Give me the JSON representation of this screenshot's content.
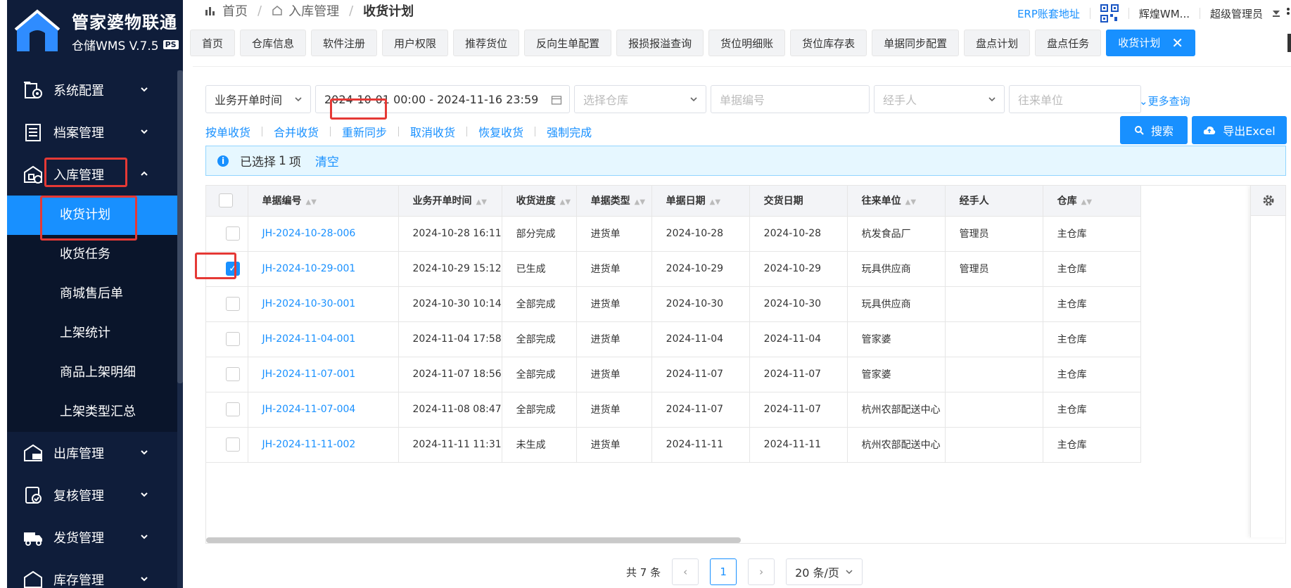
{
  "app": {
    "logo_title": "管家婆物联通",
    "logo_subtitle": "仓储WMS V.7.5",
    "logo_badge": "PS"
  },
  "sidebar": {
    "groups": [
      {
        "label": "系统配置",
        "icon": "gear-doc-icon"
      },
      {
        "label": "档案管理",
        "icon": "archive-icon"
      },
      {
        "label": "入库管理",
        "icon": "inbound-icon",
        "expanded": true
      },
      {
        "label": "出库管理",
        "icon": "outbound-icon"
      },
      {
        "label": "复核管理",
        "icon": "review-icon"
      },
      {
        "label": "发货管理",
        "icon": "truck-icon"
      },
      {
        "label": "库存管理",
        "icon": "stock-icon"
      }
    ],
    "inbound_items": [
      {
        "label": "收货计划",
        "active": true
      },
      {
        "label": "收货任务"
      },
      {
        "label": "商城售后单"
      },
      {
        "label": "上架统计"
      },
      {
        "label": "商品上架明细"
      },
      {
        "label": "上架类型汇总"
      }
    ]
  },
  "breadcrumb": {
    "home": "首页",
    "level1": "入库管理",
    "current": "收货计划"
  },
  "top_right": {
    "erp_link": "ERP账套地址",
    "user_short": "辉煌WM...",
    "role": "超级管理员"
  },
  "tabs": [
    "首页",
    "仓库信息",
    "软件注册",
    "用户权限",
    "推荐货位",
    "反向生单配置",
    "报损报溢查询",
    "货位明细账",
    "货位库存表",
    "单据同步配置",
    "盘点计划",
    "盘点任务"
  ],
  "active_tab": "收货计划",
  "filters": {
    "time_type": "业务开单时间",
    "date_range": "2024-10-01 00:00 - 2024-11-16 23:59",
    "warehouse_placeholder": "选择仓库",
    "bill_no_placeholder": "单据编号",
    "handler_placeholder": "经手人",
    "partner_placeholder": "往来单位",
    "more": "更多查询"
  },
  "actions": [
    "按单收货",
    "合并收货",
    "重新同步",
    "取消收货",
    "恢复收货",
    "强制完成"
  ],
  "buttons": {
    "search": "搜索",
    "export": "导出Excel"
  },
  "selection": {
    "prefix": "已选择",
    "count": "1",
    "suffix": "项",
    "clear": "清空"
  },
  "table": {
    "columns": [
      "单据编号",
      "业务开单时间",
      "收货进度",
      "单据类型",
      "单据日期",
      "交货日期",
      "往来单位",
      "经手人",
      "仓库"
    ],
    "rows": [
      {
        "no": "JH-2024-10-28-006",
        "time": "2024-10-28 16:11",
        "progress": "部分完成",
        "type": "进货单",
        "date": "2024-10-28",
        "delivery": "2024-10-28",
        "partner": "杭发食品厂",
        "handler": "管理员",
        "warehouse": "主仓库",
        "checked": false
      },
      {
        "no": "JH-2024-10-29-001",
        "time": "2024-10-29 15:12",
        "progress": "已生成",
        "type": "进货单",
        "date": "2024-10-29",
        "delivery": "2024-10-29",
        "partner": "玩具供应商",
        "handler": "管理员",
        "warehouse": "主仓库",
        "checked": true
      },
      {
        "no": "JH-2024-10-30-001",
        "time": "2024-10-30 10:14",
        "progress": "全部完成",
        "type": "进货单",
        "date": "2024-10-30",
        "delivery": "2024-10-30",
        "partner": "玩具供应商",
        "handler": "",
        "warehouse": "主仓库",
        "checked": false
      },
      {
        "no": "JH-2024-11-04-001",
        "time": "2024-11-04 17:58",
        "progress": "全部完成",
        "type": "进货单",
        "date": "2024-11-04",
        "delivery": "2024-11-04",
        "partner": "管家婆",
        "handler": "",
        "warehouse": "主仓库",
        "checked": false
      },
      {
        "no": "JH-2024-11-07-001",
        "time": "2024-11-07 18:56",
        "progress": "全部完成",
        "type": "进货单",
        "date": "2024-11-07",
        "delivery": "2024-11-07",
        "partner": "管家婆",
        "handler": "",
        "warehouse": "主仓库",
        "checked": false
      },
      {
        "no": "JH-2024-11-07-004",
        "time": "2024-11-08 08:47",
        "progress": "全部完成",
        "type": "进货单",
        "date": "2024-11-07",
        "delivery": "2024-11-07",
        "partner": "杭州农部配送中心",
        "handler": "",
        "warehouse": "主仓库",
        "checked": false
      },
      {
        "no": "JH-2024-11-11-002",
        "time": "2024-11-11 11:31",
        "progress": "未生成",
        "type": "进货单",
        "date": "2024-11-11",
        "delivery": "2024-11-11",
        "partner": "杭州农部配送中心",
        "handler": "",
        "warehouse": "主仓库",
        "checked": false
      }
    ]
  },
  "pagination": {
    "total": "共 7 条",
    "current_page": "1",
    "page_size": "20 条/页"
  },
  "colors": {
    "sidebar_bg": "#0f1d3a",
    "accent": "#1890ff",
    "highlight_box": "#e53935"
  }
}
